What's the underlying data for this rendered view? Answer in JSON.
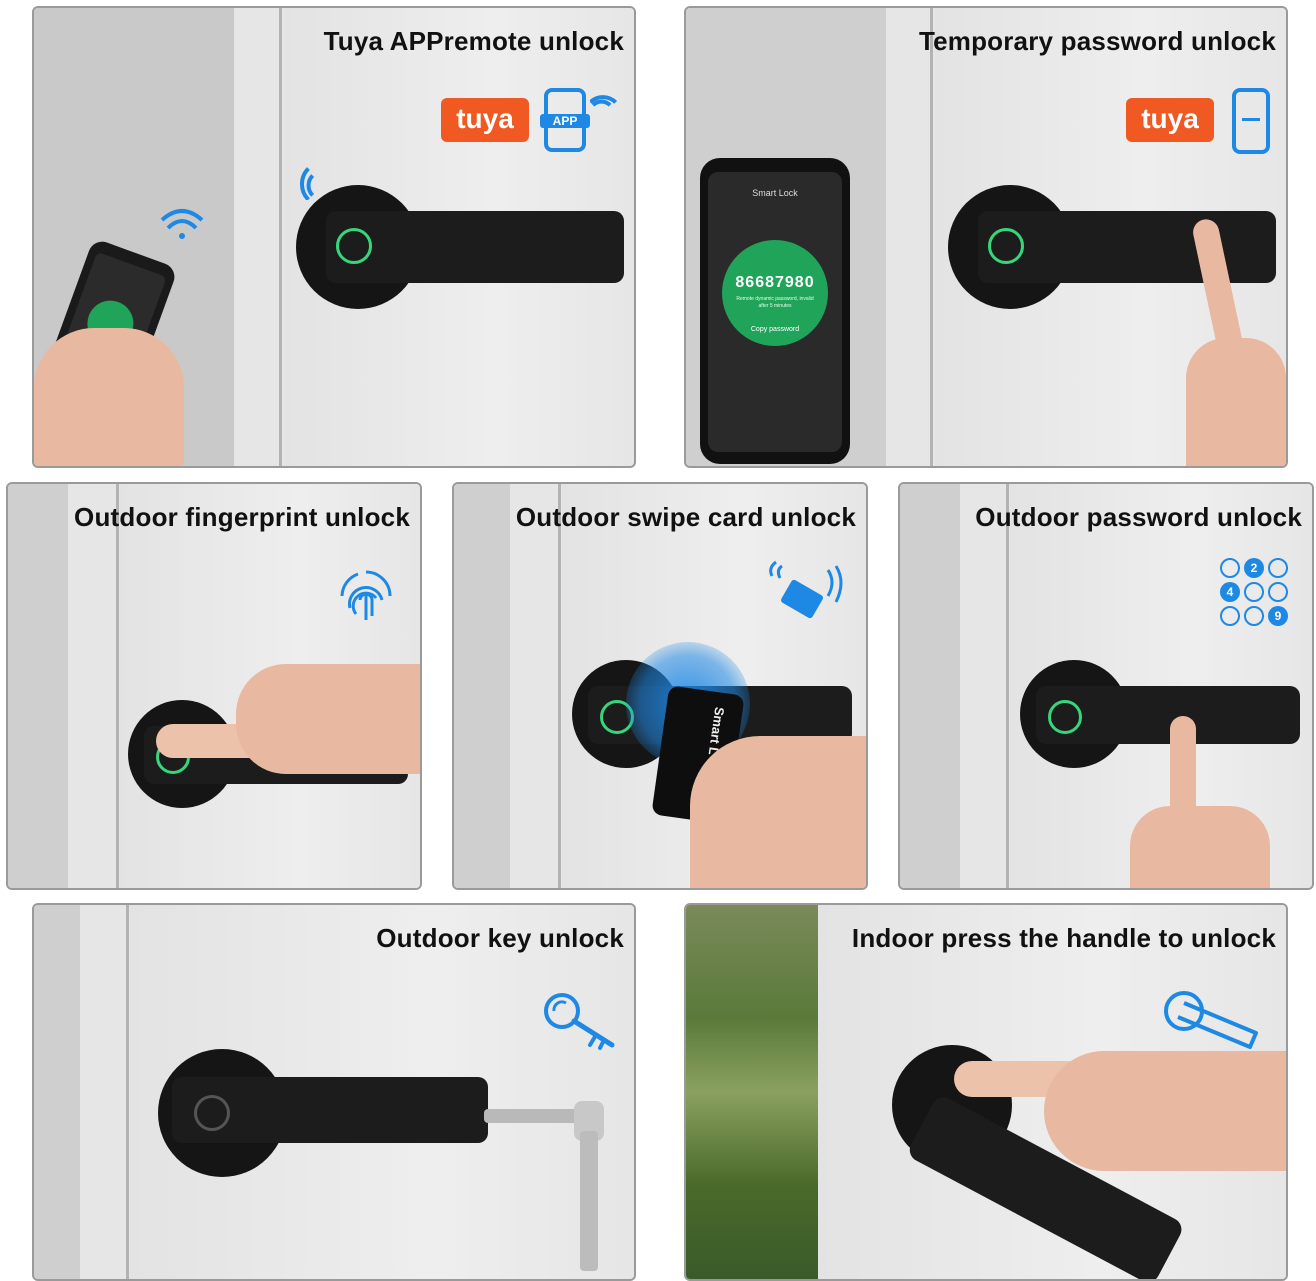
{
  "panels": [
    {
      "title": "Tuya APPremote unlock",
      "logo": "tuya",
      "app_badge": "APP",
      "icons": [
        "phone-app-icon",
        "wifi-icon"
      ]
    },
    {
      "title": "Temporary password unlock",
      "logo": "tuya",
      "phone": {
        "app_title": "Smart Lock",
        "code": "86687980",
        "note": "Remote dynamic password, invalid after 5 minutes",
        "action": "Copy password"
      },
      "icons": [
        "phone-icon"
      ]
    },
    {
      "title": "Outdoor fingerprint unlock",
      "icons": [
        "fingerprint-icon"
      ]
    },
    {
      "title": "Outdoor swipe card unlock",
      "card_text": "Smart L",
      "icons": [
        "card-swipe-icon"
      ]
    },
    {
      "title": "Outdoor password unlock",
      "keypad_digits": [
        "2",
        "4",
        "9"
      ],
      "icons": [
        "keypad-icon"
      ]
    },
    {
      "title": "Outdoor key unlock",
      "icons": [
        "key-icon"
      ]
    },
    {
      "title": "Indoor press the handle to unlock",
      "icons": [
        "handle-icon"
      ]
    }
  ],
  "colors": {
    "accent_blue": "#1e88e5",
    "tuya_orange": "#f05a22",
    "fingerprint_green": "#37d67a",
    "app_green": "#1fa45a"
  }
}
